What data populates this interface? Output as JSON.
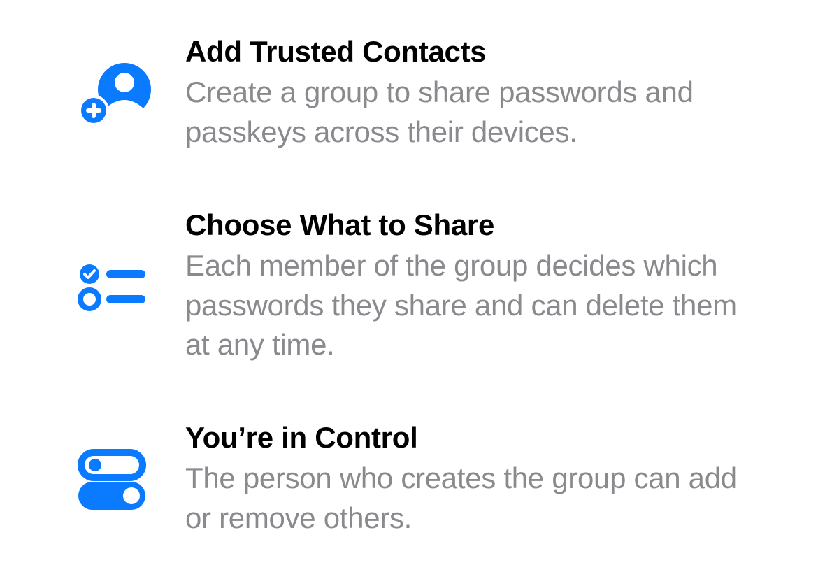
{
  "colors": {
    "accent": "#0a7aff",
    "title": "#000000",
    "desc": "#8a8a8e"
  },
  "features": [
    {
      "icon": "add-contact-icon",
      "title": "Add Trusted Contacts",
      "desc": "Create a group to share passwords and passkeys across their devices."
    },
    {
      "icon": "checklist-icon",
      "title": "Choose What to Share",
      "desc": "Each member of the group decides which passwords they share and can delete them at any time."
    },
    {
      "icon": "toggles-icon",
      "title": "You’re in Control",
      "desc": "The person who creates the group can add or remove others."
    }
  ]
}
